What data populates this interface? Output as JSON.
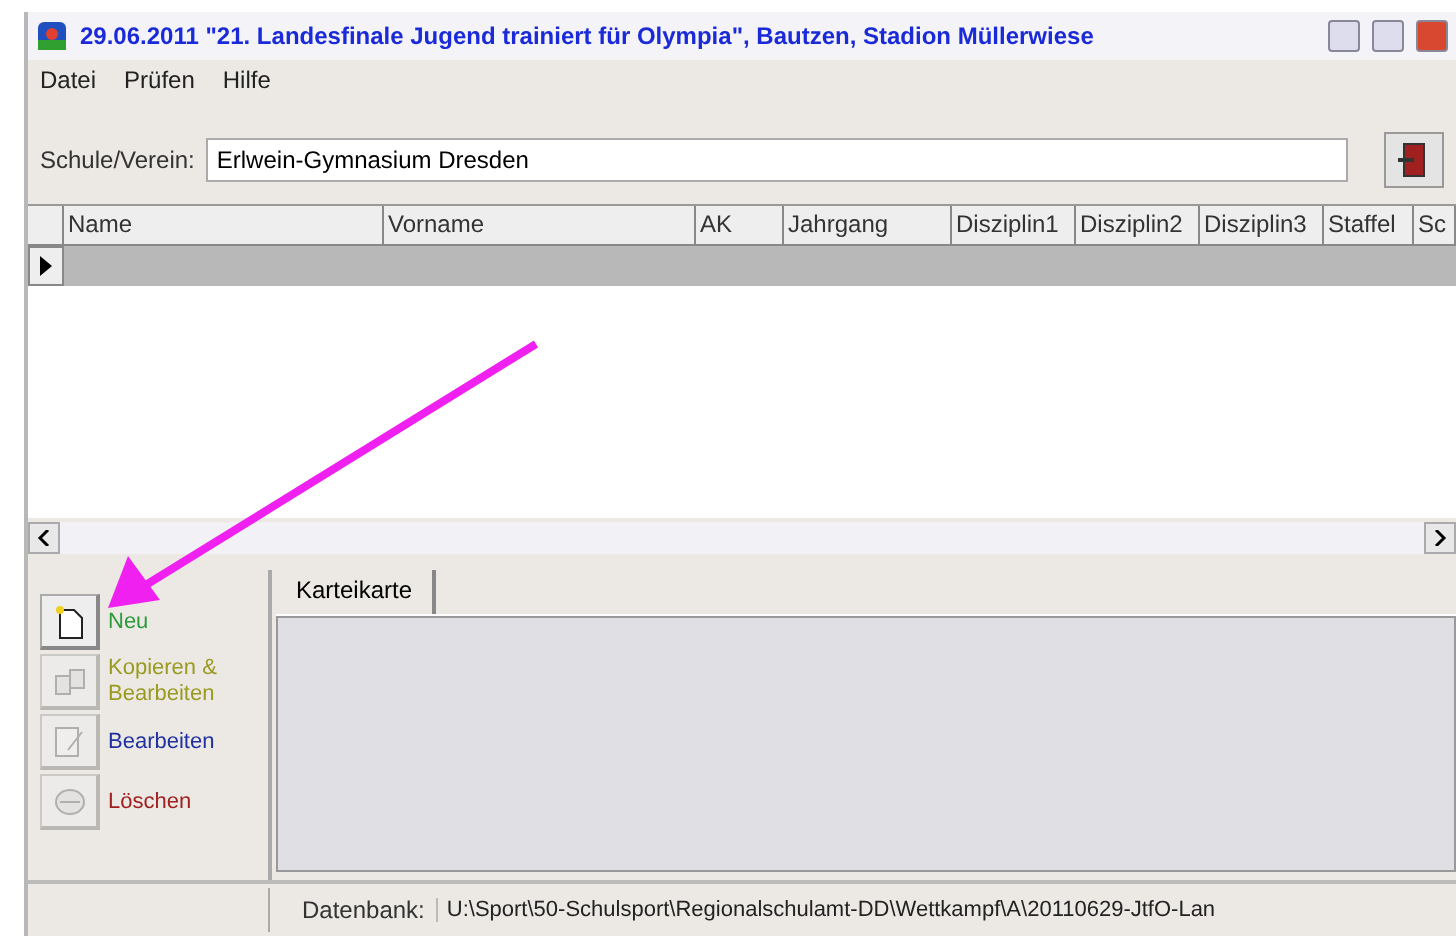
{
  "window": {
    "title": "29.06.2011 \"21. Landesfinale Jugend trainiert für Olympia\", Bautzen, Stadion Müllerwiese"
  },
  "menu": [
    "Datei",
    "Prüfen",
    "Hilfe"
  ],
  "school": {
    "label": "Schule/Verein:",
    "value": "Erlwein-Gymnasium Dresden"
  },
  "table": {
    "columns": [
      "Name",
      "Vorname",
      "AK",
      "Jahrgang",
      "Disziplin1",
      "Disziplin2",
      "Disziplin3",
      "Staffel",
      "Sc"
    ],
    "rows": [
      {
        "selected": true
      }
    ]
  },
  "actions": [
    {
      "label": "Neu",
      "color": "#2a9a3a",
      "enabled": true,
      "kind": "new"
    },
    {
      "label": "Kopieren & Bearbeiten",
      "color": "#9a9a20",
      "enabled": false,
      "kind": "copy"
    },
    {
      "label": "Bearbeiten",
      "color": "#2030a0",
      "enabled": false,
      "kind": "edit"
    },
    {
      "label": "Löschen",
      "color": "#a02020",
      "enabled": false,
      "kind": "delete"
    }
  ],
  "tabs": [
    {
      "label": "Karteikarte",
      "selected": true
    }
  ],
  "status_bar": {
    "label": "Datenbank:",
    "path": "U:\\Sport\\50-Schulsport\\Regionalschulamt-DD\\Wettkampf\\A\\20110629-JtfO-Lan"
  }
}
